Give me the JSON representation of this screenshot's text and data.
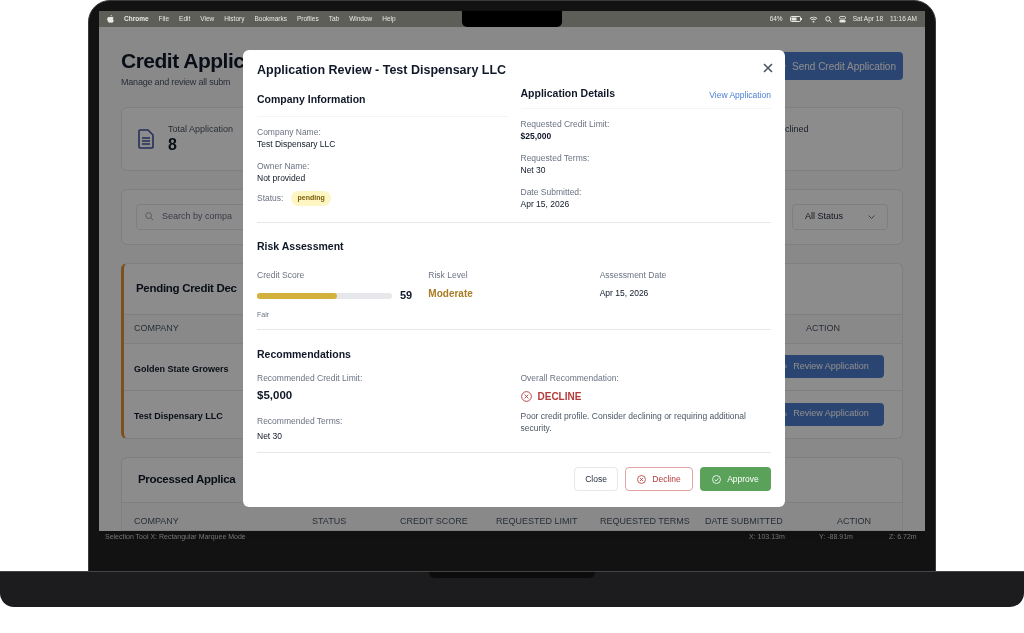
{
  "menu_bar": {
    "app": "Chrome",
    "items": [
      "File",
      "Edit",
      "View",
      "History",
      "Bookmarks",
      "Profiles",
      "Tab",
      "Window",
      "Help"
    ],
    "battery": "64%",
    "date": "Sat Apr 18",
    "time": "11:16 AM"
  },
  "page": {
    "title": "Credit Applic",
    "subtitle": "Manage and review all subm",
    "send_button": "Send Credit Application"
  },
  "stats": {
    "total_label": "Total Application",
    "total_value": "8",
    "declined_label": "clined"
  },
  "filters": {
    "search_placeholder": "Search by compa",
    "status_select": "All Status"
  },
  "pending": {
    "title": "Pending Credit Dec",
    "columns": [
      "COMPANY",
      "ACTION"
    ],
    "rows": [
      {
        "company": "Golden State Growers",
        "action": "Review Application"
      },
      {
        "company": "Test Dispensary LLC",
        "action": "Review Application"
      }
    ]
  },
  "processed": {
    "title": "Processed Applica",
    "columns": [
      "COMPANY",
      "STATUS",
      "CREDIT SCORE",
      "REQUESTED LIMIT",
      "REQUESTED TERMS",
      "DATE SUBMITTED",
      "ACTION"
    ]
  },
  "modal": {
    "title": "Application Review - Test Dispensary LLC",
    "company_info": {
      "heading": "Company Information",
      "fields": [
        {
          "label": "Company Name:",
          "value": "Test Dispensary LLC"
        },
        {
          "label": "Owner Name:",
          "value": "Not provided"
        }
      ],
      "status_label": "Status:",
      "status": "pending"
    },
    "application_details": {
      "heading": "Application Details",
      "link": "View Application",
      "fields": [
        {
          "label": "Requested Credit Limit:",
          "value": "$25,000",
          "emphasis": true
        },
        {
          "label": "Requested Terms:",
          "value": "Net 30",
          "emphasis": false
        },
        {
          "label": "Date Submitted:",
          "value": "Apr 15, 2026",
          "emphasis": false
        }
      ]
    },
    "risk": {
      "heading": "Risk Assessment",
      "credit_score_label": "Credit Score",
      "level": 0.59,
      "score": "59",
      "rating": "Fair",
      "risk_level_label": "Risk Level",
      "risk_level": "Moderate",
      "assessment_date_label": "Assessment Date",
      "assessment_date": "Apr 15, 2026"
    },
    "recommendations": {
      "heading": "Recommendations",
      "limit_label": "Recommended Credit Limit:",
      "limit": "$5,000",
      "terms_label": "Recommended Terms:",
      "terms": "Net 30",
      "overall_label": "Overall Recommendation:",
      "verdict": "DECLINE",
      "note": "Poor credit profile. Consider declining or requiring additional security."
    },
    "buttons": [
      {
        "kind": "close",
        "label": "Close"
      },
      {
        "kind": "decline",
        "label": "Decline"
      },
      {
        "kind": "approve",
        "label": "Approve"
      }
    ]
  },
  "status_strip": {
    "tool": "Selection Tool X: Rectangular Marquee Mode",
    "x": "X: 103.13m",
    "y": "Y: -88.91m",
    "z": "Z: 6.72m"
  }
}
